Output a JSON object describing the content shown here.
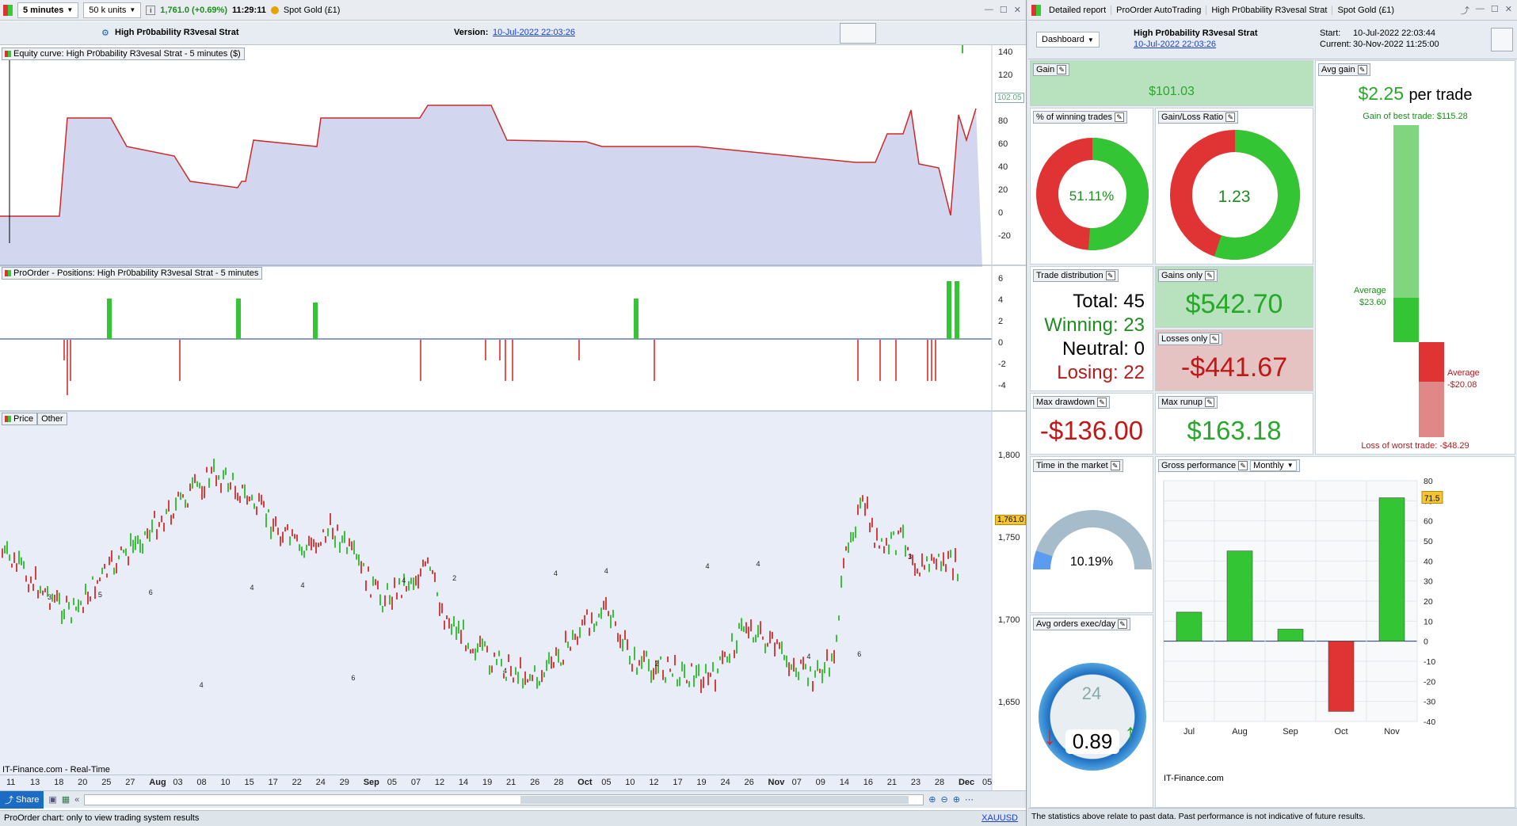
{
  "toolbar": {
    "timeframe": "5 minutes",
    "units": "50 k units",
    "price": "1,761.0 (+0.69%)",
    "time": "11:29:11",
    "instrument": "Spot Gold (£1)"
  },
  "header": {
    "strategy": "High Pr0bability R3vesal Strat",
    "version_label": "Version:",
    "version_date": "10-Jul-2022 22:03:26"
  },
  "equity": {
    "label": "Equity curve: High Pr0bability R3vesal Strat - 5 minutes ($)",
    "yticks": [
      "140",
      "120",
      "100",
      "80",
      "60",
      "40",
      "20",
      "0",
      "-20"
    ],
    "current": "102.05"
  },
  "positions": {
    "label": "ProOrder - Positions: High Pr0bability R3vesal Strat - 5 minutes",
    "yticks": [
      "6",
      "4",
      "2",
      "0",
      "-2",
      "-4"
    ]
  },
  "price": {
    "tab_price": "Price",
    "tab_other": "Other",
    "yticks": [
      "1,800",
      "1,750",
      "1,700",
      "1,650"
    ],
    "current": "1,761.0",
    "source": "IT-Finance.com - Real-Time",
    "markers": [
      "3",
      "5",
      "6",
      "4",
      "4",
      "4",
      "6",
      "4",
      "2",
      "4",
      "4",
      "4",
      "2",
      "4",
      "4",
      "4",
      "6",
      "3"
    ]
  },
  "xaxis": {
    "labels": [
      "11",
      "13",
      "18",
      "20",
      "25",
      "27",
      "Aug",
      "03",
      "08",
      "10",
      "15",
      "17",
      "22",
      "24",
      "29",
      "Sep",
      "05",
      "07",
      "12",
      "14",
      "19",
      "21",
      "26",
      "28",
      "Oct",
      "05",
      "10",
      "12",
      "17",
      "19",
      "24",
      "26",
      "Nov",
      "07",
      "09",
      "14",
      "16",
      "21",
      "23",
      "28",
      "Dec",
      "05"
    ]
  },
  "bottombar": {
    "share": "Share",
    "symbol": "XAUUSD",
    "status": "ProOrder chart: only to view trading system results"
  },
  "right": {
    "tabs": [
      "Detailed report",
      "ProOrder AutoTrading",
      "High Pr0bability R3vesal Strat",
      "Spot Gold (£1)"
    ],
    "dashboard": "Dashboard",
    "strategy": "High Pr0bability R3vesal Strat",
    "strategy_date": "10-Jul-2022 22:03:26",
    "start_label": "Start:",
    "start": "10-Jul-2022 22:03:44",
    "current_label": "Current:",
    "current": "30-Nov-2022 11:25:00",
    "gain_label": "Gain",
    "gain": "$101.03",
    "avg_gain_label": "Avg gain",
    "avg_gain": "$2.25",
    "per_trade": "per trade",
    "best_trade": "Gain of best trade: $115.28",
    "avg_pos_label": "Average",
    "avg_pos": "$23.60",
    "avg_neg_label": "Average",
    "avg_neg": "-$20.08",
    "worst_trade": "Loss of worst trade: -$48.29",
    "winning_label": "% of winning trades",
    "winning_pct": "51.11%",
    "gl_label": "Gain/Loss Ratio",
    "gl_ratio": "1.23",
    "dist_label": "Trade distribution",
    "total": "Total: 45",
    "winning": "Winning: 23",
    "neutral": "Neutral: 0",
    "losing": "Losing: 22",
    "gains_label": "Gains only",
    "gains": "$542.70",
    "losses_label": "Losses only",
    "losses": "-$441.67",
    "dd_label": "Max drawdown",
    "dd": "-$136.00",
    "runup_label": "Max runup",
    "runup": "$163.18",
    "time_label": "Time in the market",
    "time_pct": "10.19%",
    "time_fraction": 0.1019,
    "orders_label": "Avg orders exec/day",
    "orders_hours": "24",
    "orders": "0.89",
    "gross_label": "Gross performance",
    "gross_period": "Monthly",
    "gross_source": "IT-Finance.com",
    "disclaimer": "The statistics above relate to past data. Past performance is not indicative of future results."
  },
  "chart_data": {
    "type": "bar",
    "title": "Gross performance",
    "categories": [
      "Jul",
      "Aug",
      "Sep",
      "Oct",
      "Nov"
    ],
    "values": [
      14.5,
      45,
      6,
      -35,
      71.5
    ],
    "ylim": [
      -40,
      80
    ],
    "yticks": [
      -40,
      -30,
      -20,
      -10,
      0,
      10,
      20,
      30,
      40,
      50,
      60,
      70,
      80
    ]
  },
  "colors": {
    "green": "#33c533",
    "red": "#e03434",
    "accent": "#1a5fb4"
  }
}
